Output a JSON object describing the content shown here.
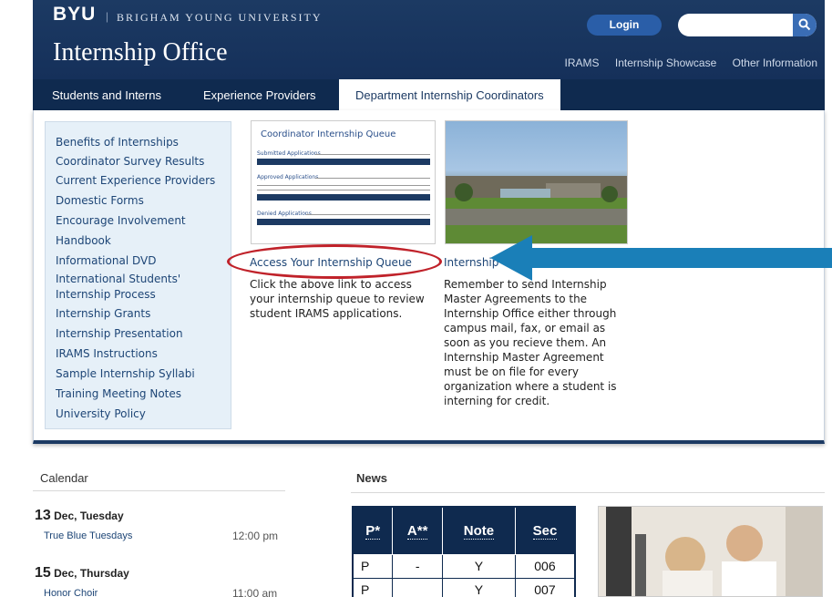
{
  "header": {
    "brand": "BYU",
    "divider": "|",
    "university": "BRIGHAM YOUNG UNIVERSITY",
    "site_title": "Internship Office",
    "login_label": "Login",
    "search_placeholder": "",
    "top_links": [
      "IRAMS",
      "Internship Showcase",
      "Other Information"
    ]
  },
  "nav": {
    "tabs": [
      "Students and Interns",
      "Experience Providers",
      "Department Internship Coordinators"
    ],
    "active_index": 2
  },
  "sidebar": {
    "items": [
      "Benefits of Internships",
      "Coordinator Survey Results",
      "Current Experience Providers",
      "Domestic Forms",
      "Encourage Involvement",
      "Handbook",
      "Informational DVD",
      "International Students'",
      "Internship Process",
      "Internship Grants",
      "Internship Presentation",
      "IRAMS Instructions",
      "Sample Internship Syllabi",
      "Training Meeting Notes",
      "University Policy"
    ]
  },
  "queue_card": {
    "title": "Coordinator Internship Queue",
    "sections": [
      "Submitted Applications",
      "Approved Applications",
      "Denied Applications"
    ]
  },
  "main": {
    "queue_link": "Access Your Internship Queue",
    "queue_desc": "Click the above link to access your internship queue to review student IRAMS applications.",
    "internship_link": "Internship",
    "internship_desc": "Remember to send Internship Master Agreements to the Internship Office either through campus mail, fax, or email as soon as you recieve them. An Internship Master Agreement must be on file for every organization where a student is interning for credit."
  },
  "calendar": {
    "title": "Calendar",
    "days": [
      {
        "num": "13",
        "label": "Dec, Tuesday",
        "event": "True Blue Tuesdays",
        "time": "12:00 pm"
      },
      {
        "num": "15",
        "label": "Dec, Thursday",
        "event": "Honor Choir",
        "time": "11:00 am"
      }
    ]
  },
  "news": {
    "title": "News",
    "table": {
      "headers": [
        "P*",
        "A**",
        "Note",
        "Sec"
      ],
      "rows": [
        [
          "P",
          "-",
          "Y",
          "006"
        ],
        [
          "P",
          "",
          "Y",
          "007"
        ]
      ]
    }
  },
  "colors": {
    "header_bg": "#1c3a63",
    "nav_bg": "#0f2a4f",
    "link": "#1d4576",
    "annotation_red": "#c0222a",
    "annotation_blue": "#1a7fb8"
  }
}
